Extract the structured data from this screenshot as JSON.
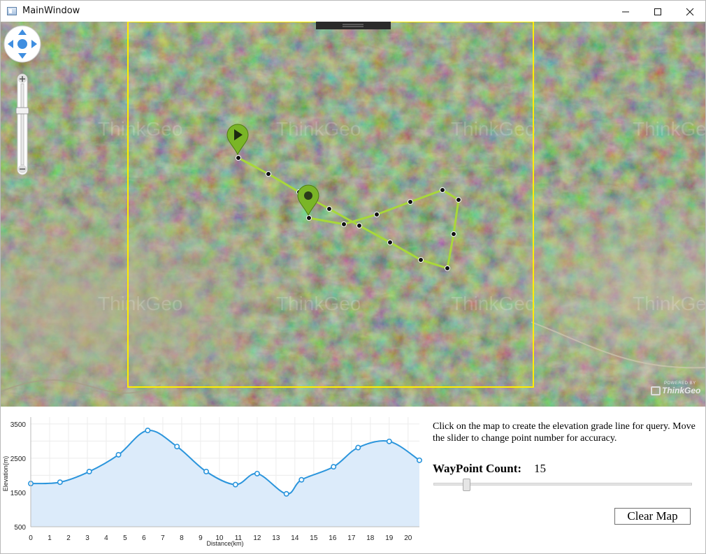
{
  "window": {
    "title": "MainWindow"
  },
  "map": {
    "watermark": "ThinkGeo",
    "powered_by": "POWERED BY",
    "powered_brand": "ThinkGeo"
  },
  "panel": {
    "instructions": "Click on the map to create the elevation grade line for query. Move the slider to change point number for accuracy.",
    "waypoint_label": "WayPoint Count:",
    "waypoint_value": "15",
    "clear_button": "Clear Map"
  },
  "colors": {
    "route": "#a8d83a",
    "marker": "#7ab527",
    "bbox": "#ffee00",
    "chart_line": "#2b95dc",
    "chart_fill": "#dcebfa"
  },
  "chart_data": {
    "type": "area",
    "xlabel": "Distance(km)",
    "ylabel": "Elevation(m)",
    "x_ticks": [
      "0",
      "1",
      "2",
      "3",
      "4",
      "5",
      "6",
      "7",
      "8",
      "9",
      "10",
      "11",
      "12",
      "13",
      "14",
      "15",
      "16",
      "17",
      "18",
      "19",
      "20"
    ],
    "y_ticks": [
      "500",
      "1500",
      "2500",
      "3500"
    ],
    "xlim": [
      0,
      20.6
    ],
    "ylim": [
      500,
      3700
    ],
    "grid": true,
    "x": [
      0,
      1.55,
      3.1,
      4.65,
      6.2,
      7.75,
      9.3,
      10.85,
      12.0,
      13.55,
      14.35,
      16.05,
      17.35,
      19.0,
      20.6
    ],
    "values": [
      1760,
      1800,
      2110,
      2600,
      3310,
      2840,
      2110,
      1730,
      2050,
      1460,
      1870,
      2250,
      2810,
      2990,
      2440
    ]
  }
}
